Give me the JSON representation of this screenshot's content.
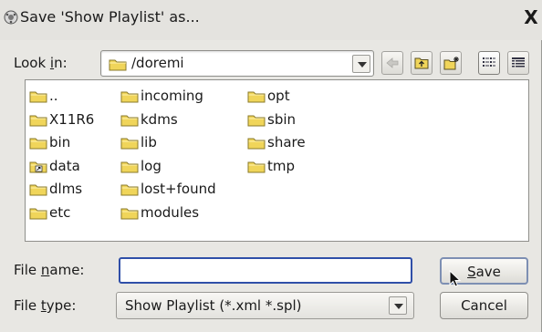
{
  "window": {
    "title": "Save 'Show Playlist' as...",
    "close_glyph": "✕",
    "close_label": "X"
  },
  "lookin": {
    "label_pre": "Look ",
    "label_mnemonic": "i",
    "label_post": "n:",
    "path": "/doremi"
  },
  "toolbar": {
    "buttons": [
      {
        "name": "back-button",
        "icon": "back-arrow-icon"
      },
      {
        "name": "parent-directory-button",
        "icon": "folder-up-icon"
      },
      {
        "name": "new-folder-button",
        "icon": "new-folder-icon"
      },
      {
        "name": "list-view-button",
        "icon": "list-view-icon",
        "active": true
      },
      {
        "name": "detail-view-button",
        "icon": "detail-view-icon"
      }
    ]
  },
  "files": {
    "columns": [
      [
        {
          "name": "..",
          "icon": "folder-icon"
        },
        {
          "name": "X11R6",
          "icon": "folder-icon"
        },
        {
          "name": "bin",
          "icon": "folder-icon"
        },
        {
          "name": "data",
          "icon": "folder-link-icon"
        },
        {
          "name": "dlms",
          "icon": "folder-icon"
        },
        {
          "name": "etc",
          "icon": "folder-icon"
        }
      ],
      [
        {
          "name": "incoming",
          "icon": "folder-icon"
        },
        {
          "name": "kdms",
          "icon": "folder-icon"
        },
        {
          "name": "lib",
          "icon": "folder-icon"
        },
        {
          "name": "log",
          "icon": "folder-icon"
        },
        {
          "name": "lost+found",
          "icon": "folder-icon"
        },
        {
          "name": "modules",
          "icon": "folder-icon"
        }
      ],
      [
        {
          "name": "opt",
          "icon": "folder-icon"
        },
        {
          "name": "sbin",
          "icon": "folder-icon"
        },
        {
          "name": "share",
          "icon": "folder-icon"
        },
        {
          "name": "tmp",
          "icon": "folder-icon"
        }
      ]
    ]
  },
  "filename": {
    "label_pre": "File ",
    "label_mnemonic": "n",
    "label_post": "ame:",
    "value": ""
  },
  "filetype": {
    "label_pre": "File ",
    "label_mnemonic": "t",
    "label_post": "ype:",
    "value": "Show Playlist (*.xml *.spl)"
  },
  "buttons": {
    "save_mnemonic": "S",
    "save_rest": "ave",
    "cancel": "Cancel"
  },
  "colors": {
    "folder_fill": "#f0d55a",
    "folder_stroke": "#8a7a2a",
    "focus_border": "#2f4fa8"
  }
}
